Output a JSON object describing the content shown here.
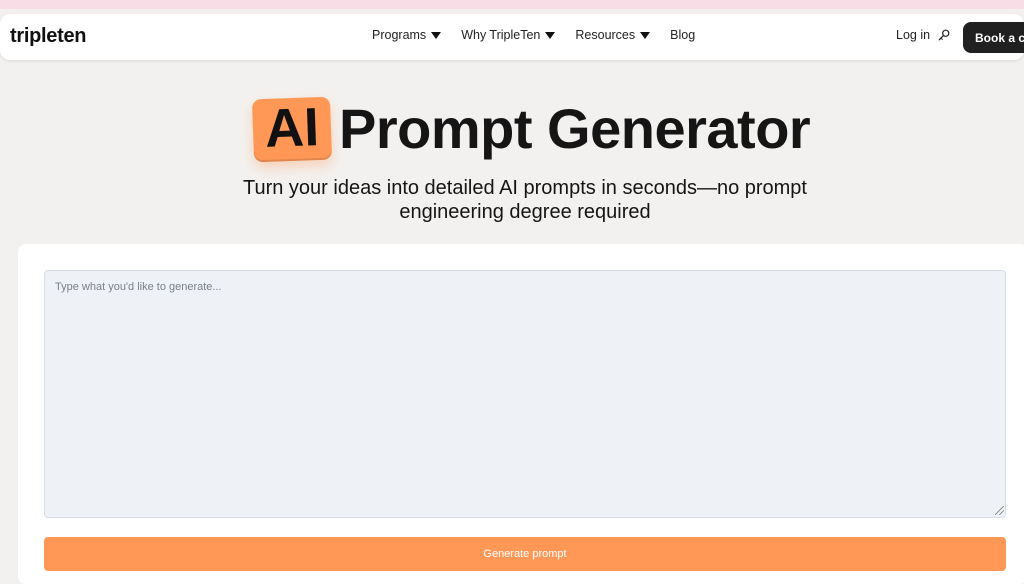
{
  "header": {
    "logo": "tripleten",
    "nav": [
      {
        "label": "Programs"
      },
      {
        "label": "Why TripleTen"
      },
      {
        "label": "Resources"
      },
      {
        "label": "Blog"
      }
    ],
    "login": "Log in",
    "cta": "Book a ca"
  },
  "hero": {
    "badge": "AI",
    "title_rest": "Prompt Generator",
    "subtitle": "Turn your ideas into detailed AI prompts in seconds—no prompt engineering degree required"
  },
  "form": {
    "placeholder": "Type what you'd like to generate...",
    "value": "",
    "button": "Generate prompt"
  },
  "colors": {
    "accent": "#ff9857",
    "header_bg": "#ffffff",
    "page_bg": "#f3f1ef",
    "top_strip": "#f8dde6",
    "cta_bg": "#202020"
  },
  "icons": {
    "login": "search-key-icon",
    "caret": "caret-down-icon"
  }
}
